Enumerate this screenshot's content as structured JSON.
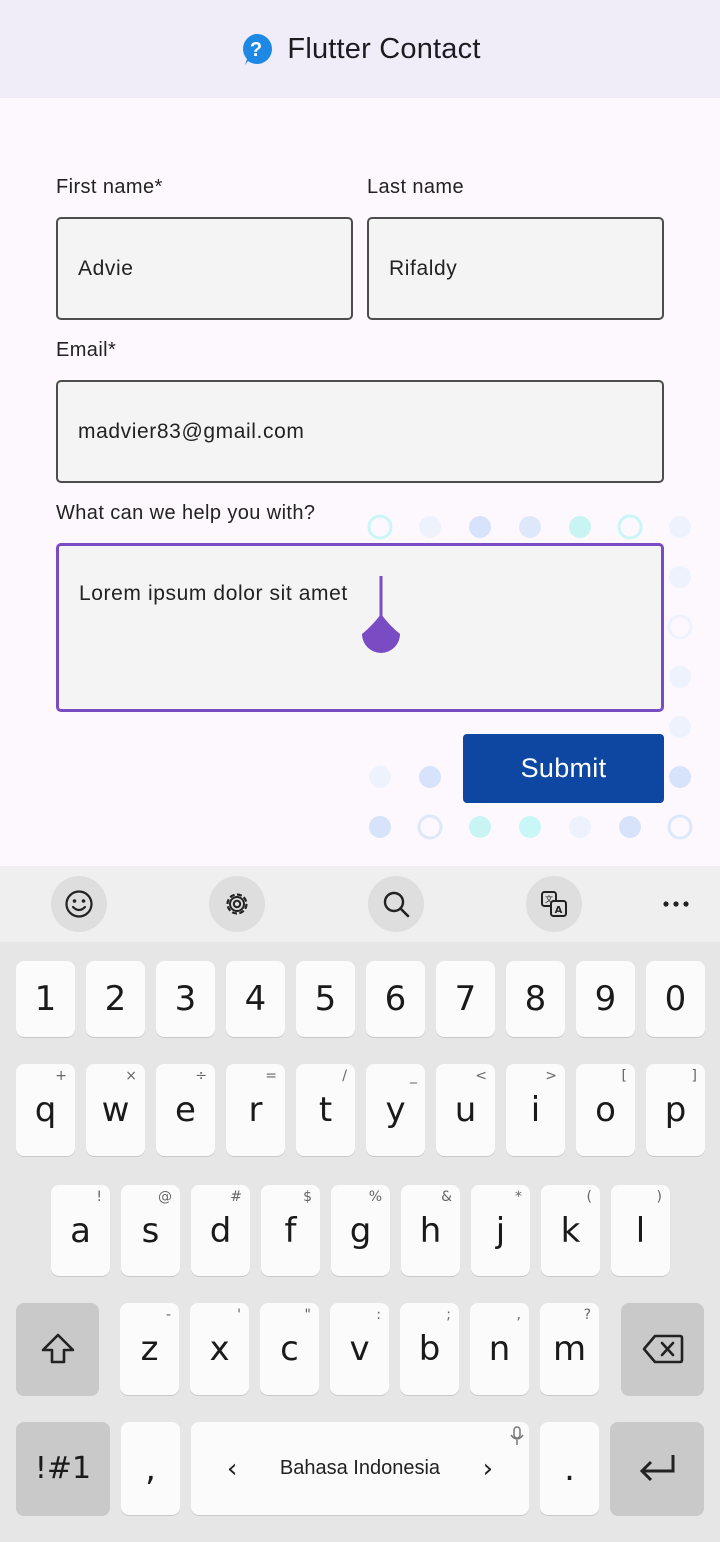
{
  "appbar": {
    "title": "Flutter Contact",
    "logo_icon": "help-bubble-icon",
    "logo_color": "#1e88e5"
  },
  "form": {
    "first_name": {
      "label": "First name*",
      "value": "Advie"
    },
    "last_name": {
      "label": "Last name",
      "value": "Rifaldy"
    },
    "email": {
      "label": "Email*",
      "value": "madvier83@gmail.com"
    },
    "message": {
      "label": "What can we help you with?",
      "value": "Lorem ipsum dolor sit amet"
    },
    "submit_label": "Submit",
    "accent_color": "#7a4cc4",
    "submit_color": "#0e47a1"
  },
  "keyboard": {
    "toolbar": [
      "emoji-icon",
      "settings-icon",
      "search-icon",
      "translate-icon",
      "more-icon"
    ],
    "numbers": [
      "1",
      "2",
      "3",
      "4",
      "5",
      "6",
      "7",
      "8",
      "9",
      "0"
    ],
    "row1": [
      {
        "k": "q",
        "s": "+"
      },
      {
        "k": "w",
        "s": "×"
      },
      {
        "k": "e",
        "s": "÷"
      },
      {
        "k": "r",
        "s": "="
      },
      {
        "k": "t",
        "s": "/"
      },
      {
        "k": "y",
        "s": "_"
      },
      {
        "k": "u",
        "s": "<"
      },
      {
        "k": "i",
        "s": ">"
      },
      {
        "k": "o",
        "s": "["
      },
      {
        "k": "p",
        "s": "]"
      }
    ],
    "row2": [
      {
        "k": "a",
        "s": "!"
      },
      {
        "k": "s",
        "s": "@"
      },
      {
        "k": "d",
        "s": "#"
      },
      {
        "k": "f",
        "s": "$"
      },
      {
        "k": "g",
        "s": "%"
      },
      {
        "k": "h",
        "s": "&"
      },
      {
        "k": "j",
        "s": "*"
      },
      {
        "k": "k",
        "s": "("
      },
      {
        "k": "l",
        "s": ")"
      }
    ],
    "row3": [
      {
        "k": "z",
        "s": "-"
      },
      {
        "k": "x",
        "s": "'"
      },
      {
        "k": "c",
        "s": "\""
      },
      {
        "k": "v",
        "s": ":"
      },
      {
        "k": "b",
        "s": ";"
      },
      {
        "k": "n",
        "s": ","
      },
      {
        "k": "m",
        "s": "?"
      }
    ],
    "symbols_label": "!#1",
    "comma": ",",
    "space_label": "Bahasa Indonesia",
    "period": "."
  }
}
